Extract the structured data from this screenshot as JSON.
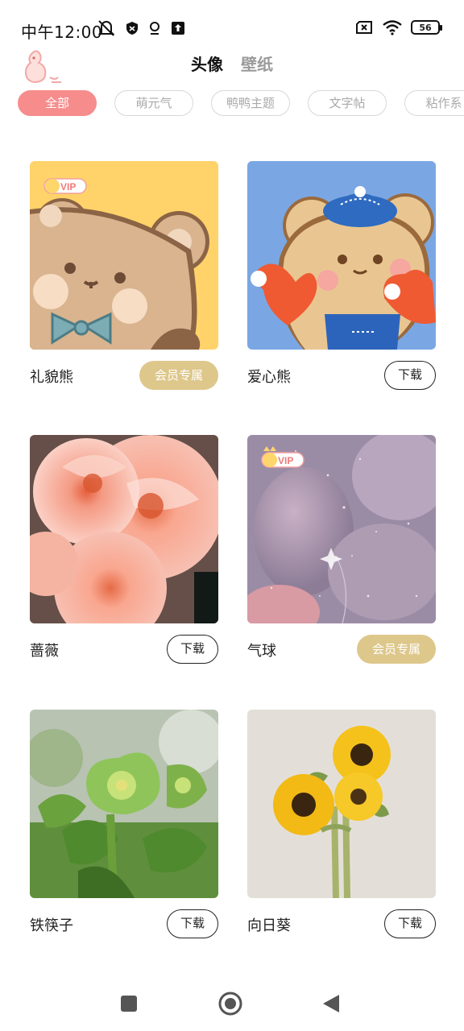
{
  "status_bar": {
    "time": "中午12:00",
    "battery": "56"
  },
  "header": {
    "tabs": [
      {
        "label": "头像",
        "active": true
      },
      {
        "label": "壁纸",
        "active": false
      }
    ]
  },
  "categories": [
    {
      "label": "全部",
      "active": true
    },
    {
      "label": "萌元气",
      "active": false
    },
    {
      "label": "鸭鸭主题",
      "active": false
    },
    {
      "label": "文字帖",
      "active": false
    },
    {
      "label": "粘作系",
      "active": false
    }
  ],
  "cards": [
    {
      "title": "礼貌熊",
      "button": "会员专属",
      "vip": true,
      "image": "bear-with-bow",
      "vip_badge": "VIP"
    },
    {
      "title": "爱心熊",
      "button": "下载",
      "vip": false,
      "image": "bear-with-hearts"
    },
    {
      "title": "蔷薇",
      "button": "下载",
      "vip": false,
      "image": "peach-roses"
    },
    {
      "title": "气球",
      "button": "会员专属",
      "vip": true,
      "image": "balloons",
      "vip_badge": "VIP"
    },
    {
      "title": "铁筷子",
      "button": "下载",
      "vip": false,
      "image": "green-hellebore"
    },
    {
      "title": "向日葵",
      "button": "下载",
      "vip": false,
      "image": "sunflowers"
    }
  ],
  "colors": {
    "accent_pink": "#f68c8c",
    "vip_gold": "#dec78b",
    "tab_highlight": "#ffd86a"
  }
}
